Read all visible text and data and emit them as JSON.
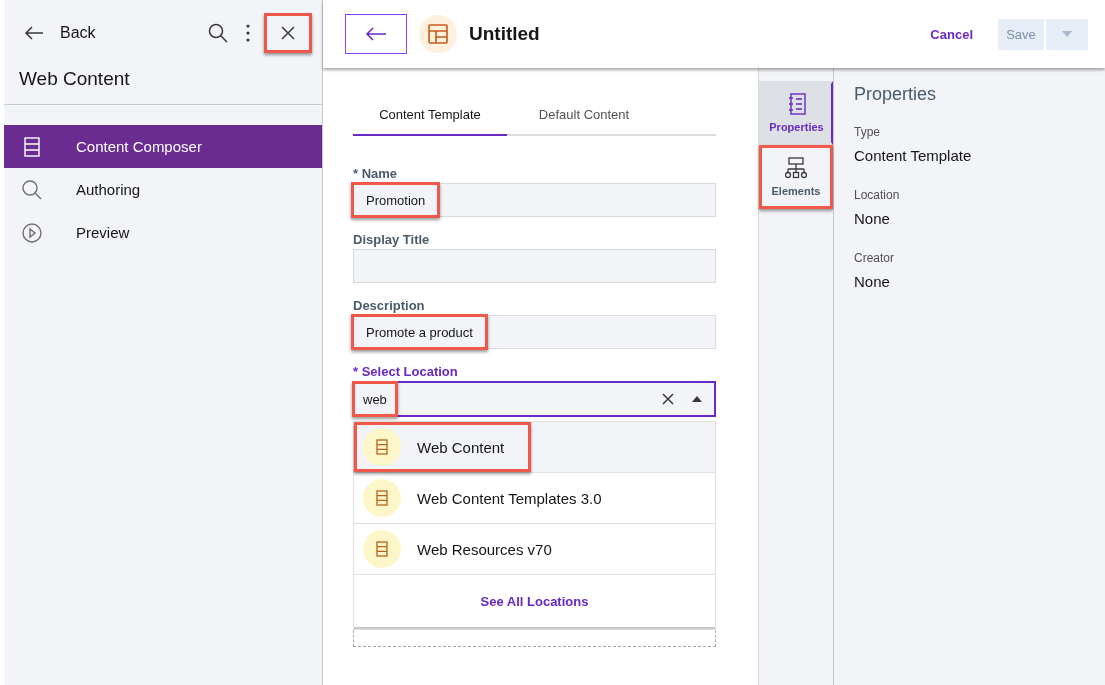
{
  "sidebar": {
    "back": "Back",
    "close_highlighted": true,
    "title": "Web Content",
    "items": [
      {
        "label": "Content Composer",
        "selected": true
      },
      {
        "label": "Authoring",
        "selected": false
      },
      {
        "label": "Preview",
        "selected": false
      }
    ]
  },
  "header": {
    "title": "Untitled",
    "cancel": "Cancel",
    "save": "Save",
    "save_disabled": true
  },
  "tabs": [
    {
      "label": "Content Template",
      "selected": true
    },
    {
      "label": "Default Content",
      "selected": false
    }
  ],
  "fields": [
    {
      "kind": "text",
      "label": "* Name",
      "value": "Promotion",
      "highlighted": true,
      "focused": false
    },
    {
      "kind": "text",
      "label": "Display Title",
      "focused": false
    },
    {
      "kind": "text",
      "label": "Description",
      "value": "Promote a product",
      "highlighted": true,
      "focused": false
    },
    {
      "kind": "combo",
      "label": "* Select Location",
      "value": "web",
      "highlighted": true,
      "focused": true,
      "expanded": true
    }
  ],
  "dropdown": {
    "options": [
      {
        "label": "Web Content",
        "selected": true,
        "highlighted": true
      },
      {
        "label": "Web Content Templates 3.0",
        "selected": false,
        "highlighted": false
      },
      {
        "label": "Web Resources v70",
        "selected": false,
        "highlighted": false
      }
    ],
    "link": "See All Locations"
  },
  "rail": [
    {
      "label": "Properties",
      "selected": true,
      "highlighted": false
    },
    {
      "label": "Elements",
      "selected": false,
      "highlighted": true
    }
  ],
  "properties": {
    "title": "Properties",
    "entries": [
      {
        "label": "Type",
        "value": "Content Template"
      },
      {
        "label": "Location",
        "value": "None"
      },
      {
        "label": "Creator",
        "value": "None"
      }
    ]
  }
}
